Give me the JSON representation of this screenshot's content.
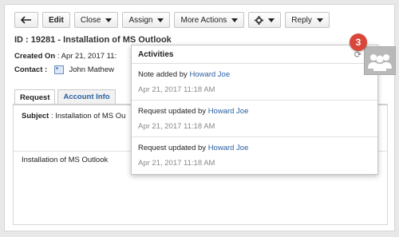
{
  "toolbar": {
    "edit": "Edit",
    "close": "Close",
    "assign": "Assign",
    "more_actions": "More Actions",
    "reply": "Reply"
  },
  "ticket": {
    "title": "ID : 19281 - Installation of MS Outlook",
    "created_label": "Created On",
    "created_value": ": Apr 21, 2017 11:",
    "contact_label": "Contact",
    "contact_colon": ":",
    "contact_name": "John Mathew"
  },
  "tabs": [
    {
      "label": "Request"
    },
    {
      "label": "Account Info"
    }
  ],
  "content": {
    "subject_label": "Subject",
    "subject_value": ": Installation of MS Ou",
    "description": "Installation of MS Outlook"
  },
  "activities": {
    "title": "Activities",
    "items": [
      {
        "text": "Note added by",
        "user": "Howard Joe",
        "time": "Apr 21, 2017 11:18 AM"
      },
      {
        "text": "Request updated by",
        "user": "Howard Joe",
        "time": "Apr 21, 2017 11:18 AM"
      },
      {
        "text": "Request updated by",
        "user": "Howard Joe",
        "time": "Apr 21, 2017 11:18 AM"
      }
    ]
  },
  "notifications": {
    "count": "3"
  },
  "colors": {
    "accent": "#2a5f9e",
    "badge": "#d9463a"
  }
}
